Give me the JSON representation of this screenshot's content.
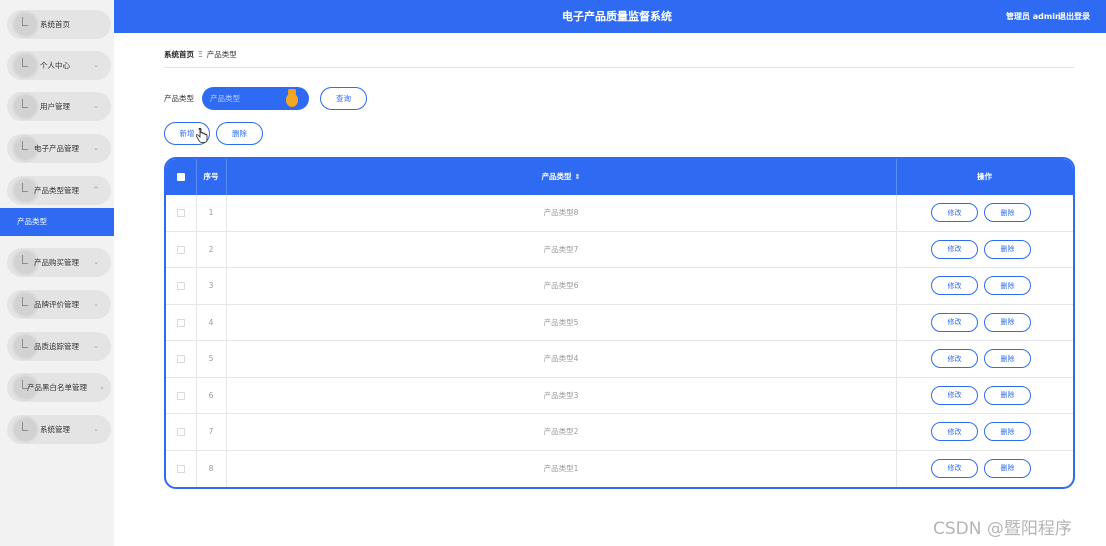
{
  "header": {
    "title": "电子产品质量监督系统",
    "user": "管理员 admin",
    "logout": "退出登录"
  },
  "sidebar": {
    "items": [
      {
        "label": "系统首页",
        "has_chevron": false
      },
      {
        "label": "个人中心",
        "has_chevron": true
      },
      {
        "label": "用户管理",
        "has_chevron": true
      },
      {
        "label": "电子产品管理",
        "has_chevron": true
      },
      {
        "label": "产品类型管理",
        "has_chevron": true,
        "expanded": true
      },
      {
        "label": "产品购买管理",
        "has_chevron": true
      },
      {
        "label": "品牌评价管理",
        "has_chevron": true
      },
      {
        "label": "品质追踪管理",
        "has_chevron": true
      },
      {
        "label": "产品黑白名单管理",
        "has_chevron": true
      },
      {
        "label": "系统管理",
        "has_chevron": true
      }
    ],
    "active_subitem": "产品类型",
    "chevron_down": "⌄",
    "chevron_up": "^"
  },
  "breadcrumb": {
    "home": "系统首页",
    "separator": "Ξ",
    "current": "产品类型"
  },
  "search": {
    "label": "产品类型",
    "placeholder": "产品类型",
    "query_button": "查询"
  },
  "actions": {
    "add_button": "新增",
    "delete_button": "删除"
  },
  "table": {
    "headers": {
      "index": "序号",
      "name": "产品类型",
      "sort_icon": "⇕",
      "operation": "操作"
    },
    "rows": [
      {
        "index": "1",
        "name": "产品类型8"
      },
      {
        "index": "2",
        "name": "产品类型7"
      },
      {
        "index": "3",
        "name": "产品类型6"
      },
      {
        "index": "4",
        "name": "产品类型5"
      },
      {
        "index": "5",
        "name": "产品类型4"
      },
      {
        "index": "6",
        "name": "产品类型3"
      },
      {
        "index": "7",
        "name": "产品类型2"
      },
      {
        "index": "8",
        "name": "产品类型1"
      }
    ],
    "edit_label": "修改",
    "delete_label": "删除"
  },
  "watermark": "CSDN @暨阳程序",
  "colors": {
    "primary": "#2f6bf2",
    "sidebar_bg": "#f2f2f2",
    "menu_pill": "#e4e4e4"
  }
}
